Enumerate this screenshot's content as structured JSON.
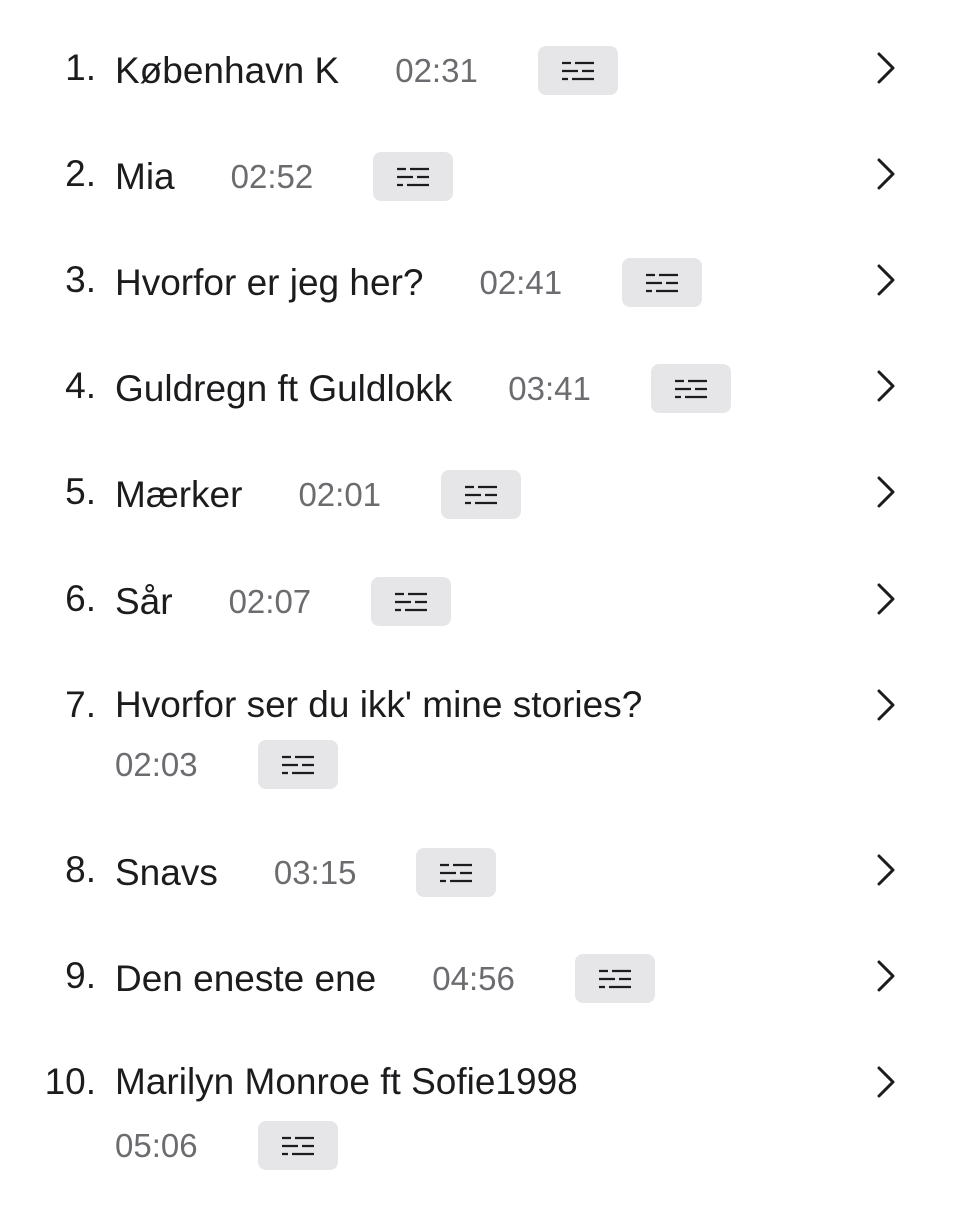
{
  "tracks": [
    {
      "number": "1.",
      "title": "København K",
      "duration": "02:31"
    },
    {
      "number": "2.",
      "title": "Mia",
      "duration": "02:52"
    },
    {
      "number": "3.",
      "title": "Hvorfor er jeg her?",
      "duration": "02:41"
    },
    {
      "number": "4.",
      "title": "Guldregn ft Guldlokk",
      "duration": "03:41"
    },
    {
      "number": "5.",
      "title": "Mærker",
      "duration": "02:01"
    },
    {
      "number": "6.",
      "title": "Sår",
      "duration": "02:07"
    },
    {
      "number": "7.",
      "title": "Hvorfor ser du ikk' mine stories?",
      "duration": "02:03"
    },
    {
      "number": "8.",
      "title": "Snavs",
      "duration": "03:15"
    },
    {
      "number": "9.",
      "title": "Den eneste ene",
      "duration": "04:56"
    },
    {
      "number": "10.",
      "title": "Marilyn Monroe ft Sofie1998",
      "duration": "05:06"
    }
  ],
  "icons": {
    "lyrics_button": "lyrics-lines-icon",
    "row_action": "chevron-right-icon"
  },
  "colors": {
    "text": "#1c1c1e",
    "duration": "#6c6c70",
    "button_bg": "#e6e6e8"
  }
}
